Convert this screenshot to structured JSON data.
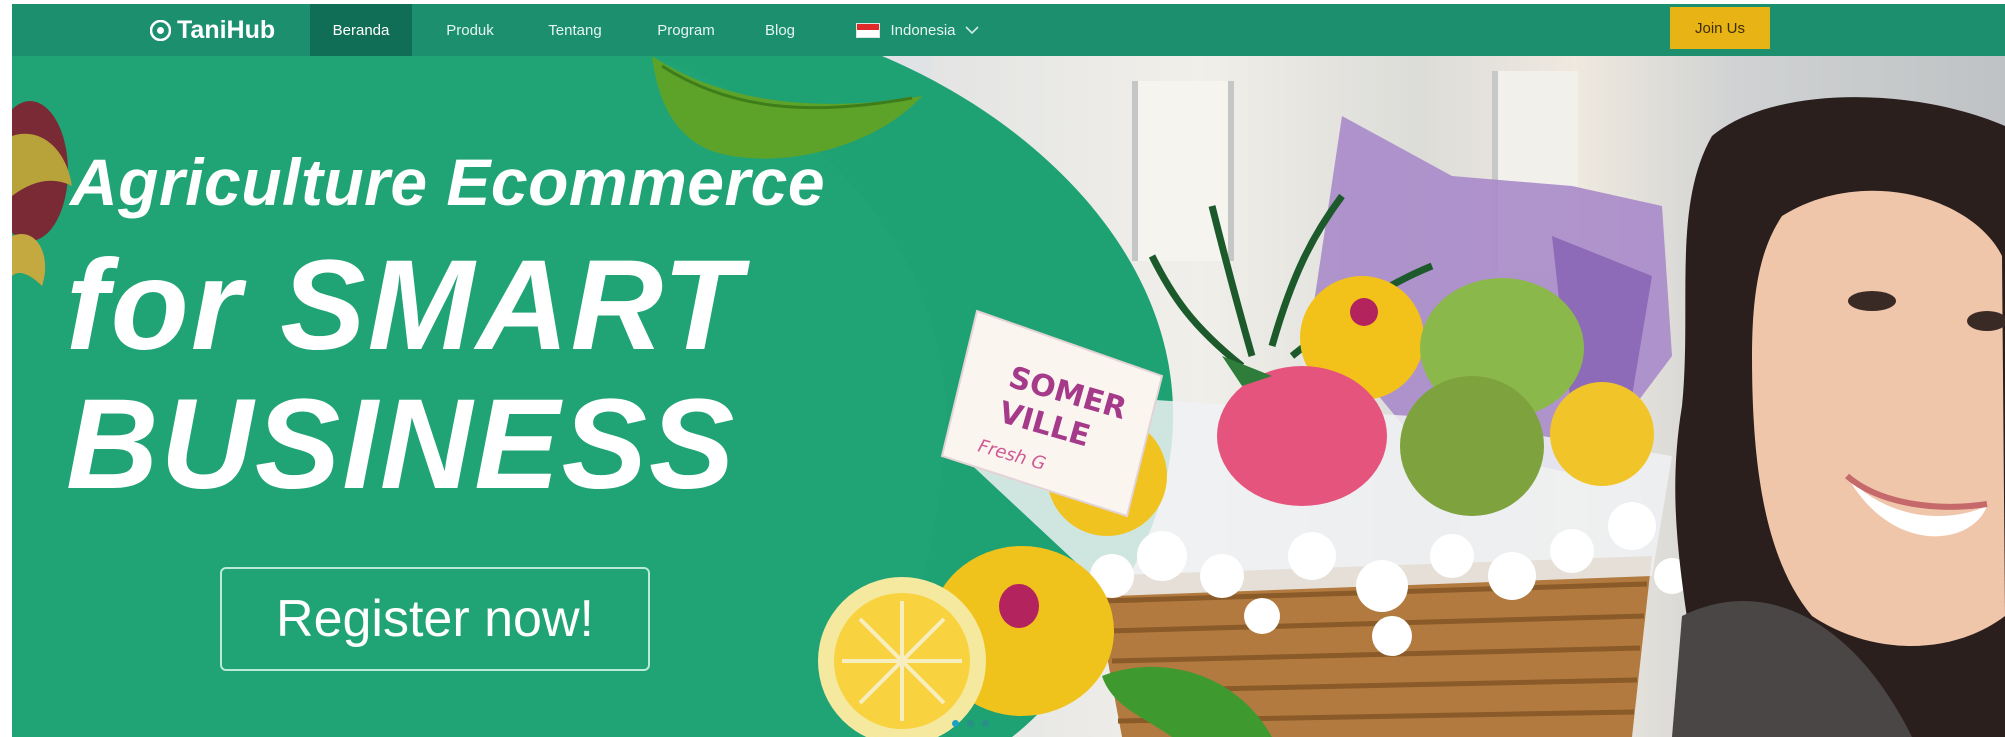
{
  "brand": {
    "name": "TaniHub",
    "logo_icon": "tanihub-logo-icon"
  },
  "nav": {
    "items": [
      {
        "label": "Beranda",
        "active": true
      },
      {
        "label": "Produk"
      },
      {
        "label": "Tentang"
      },
      {
        "label": "Program"
      },
      {
        "label": "Blog"
      }
    ],
    "language": {
      "label": "Indonesia",
      "flag": "indonesia-flag-icon",
      "icon": "chevron-down-icon"
    },
    "join_label": "Join Us"
  },
  "hero": {
    "headline_line1": "Agriculture Ecommerce",
    "headline_line2": "for SMART",
    "headline_line3": "BUSINESS",
    "cta_label": "Register now!",
    "sign_text_1": "SOMER",
    "sign_text_2": "VILLE",
    "sign_text_3": "Fresh G",
    "carousel": {
      "count": 3,
      "active_index": 0
    }
  },
  "colors": {
    "nav_bg": "#1b8f6e",
    "nav_active_bg": "#0f6e55",
    "join_bg": "#e8b315",
    "hero_green": "#1ea173"
  }
}
